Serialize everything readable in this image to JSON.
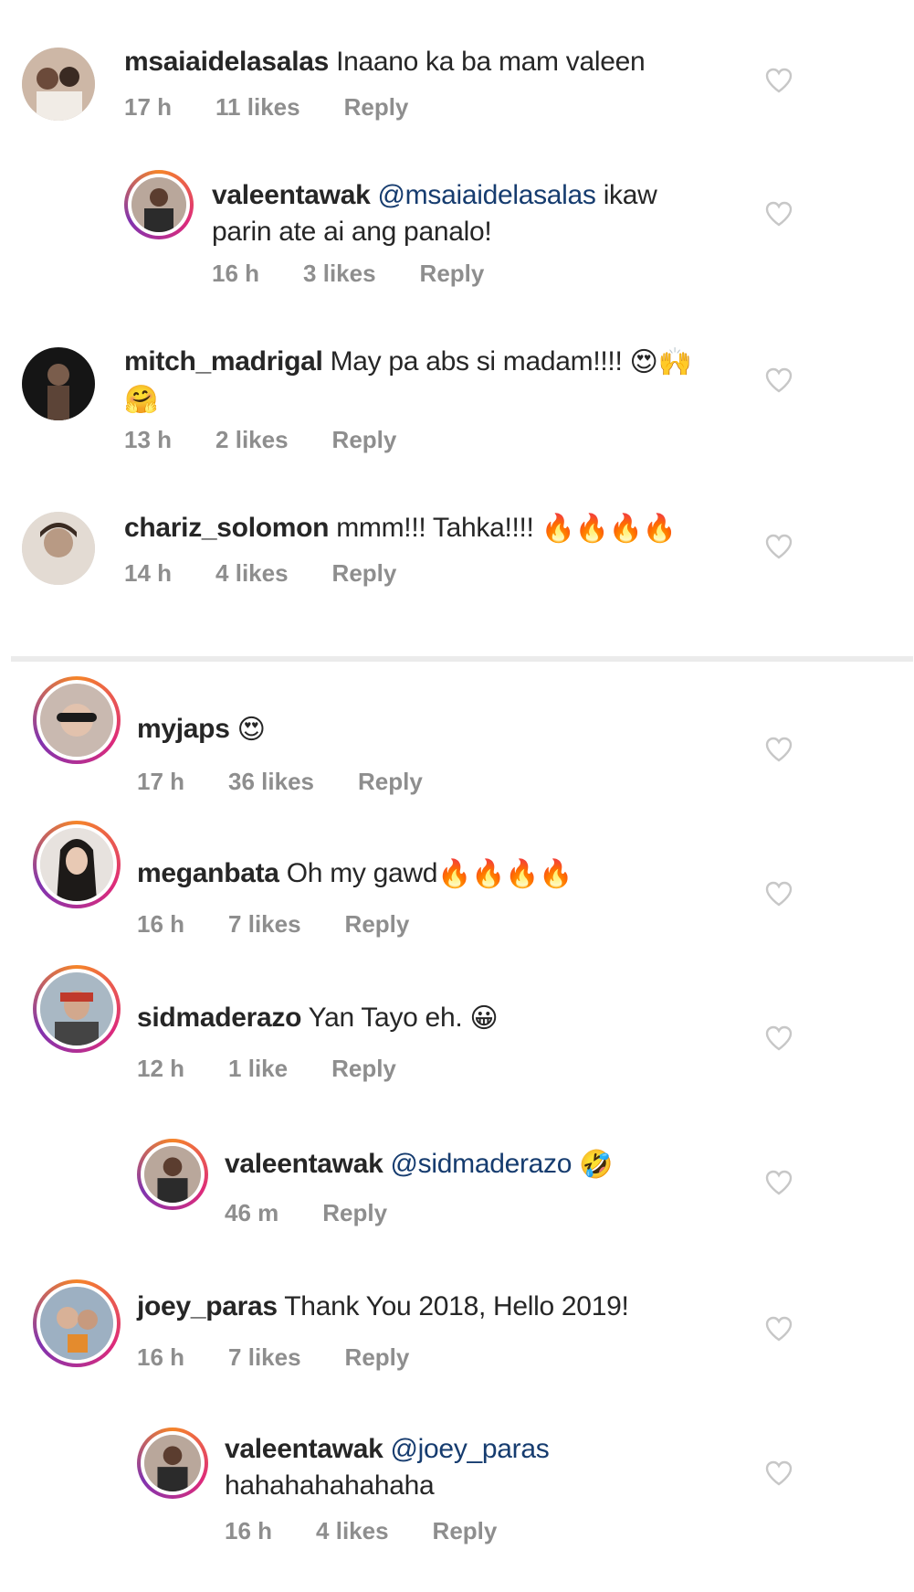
{
  "comments": [
    {
      "username": "msaiaidelasalas",
      "text": "Inaano ka ba mam valeen",
      "time": "17 h",
      "likes": "11 likes",
      "reply": "Reply",
      "emoji": ""
    },
    {
      "username": "valeentawak",
      "mention": "@msaiaidelasalas",
      "text": "ikaw",
      "text2": "parin ate ai ang panalo!",
      "time": "16 h",
      "likes": "3 likes",
      "reply": "Reply"
    },
    {
      "username": "mitch_madrigal",
      "text": "May pa abs si madam!!!!",
      "time": "13 h",
      "likes": "2 likes",
      "reply": "Reply",
      "emoji": "😍🙌",
      "emoji2": "🤗"
    },
    {
      "username": "chariz_solomon",
      "text": "mmm!!! Tahka!!!!",
      "time": "14 h",
      "likes": "4 likes",
      "reply": "Reply",
      "emoji": "🔥🔥🔥🔥"
    },
    {
      "username": "myjaps",
      "text": "",
      "time": "17 h",
      "likes": "36 likes",
      "reply": "Reply",
      "emoji": "😍"
    },
    {
      "username": "meganbata",
      "text": "Oh my gawd",
      "time": "16 h",
      "likes": "7 likes",
      "reply": "Reply",
      "emoji": "🔥🔥🔥🔥"
    },
    {
      "username": "sidmaderazo",
      "text": "Yan Tayo eh.",
      "time": "12 h",
      "likes": "1 like",
      "reply": "Reply",
      "emoji": "😀"
    },
    {
      "username": "valeentawak",
      "mention": "@sidmaderazo",
      "text": "",
      "time": "46 m",
      "likes": "",
      "reply": "Reply",
      "emoji": "🤣"
    },
    {
      "username": "joey_paras",
      "text": "Thank You 2018, Hello 2019!",
      "time": "16 h",
      "likes": "7 likes",
      "reply": "Reply"
    },
    {
      "username": "valeentawak",
      "mention": "@joey_paras",
      "text": "",
      "text2": "hahahahahahaha",
      "time": "16 h",
      "likes": "4 likes",
      "reply": "Reply"
    }
  ],
  "colors": {
    "mention": "#163c6f",
    "meta": "#8e8e8e",
    "heart": "#c7c7c7"
  },
  "icons": {
    "like": "heart-outline-icon"
  }
}
